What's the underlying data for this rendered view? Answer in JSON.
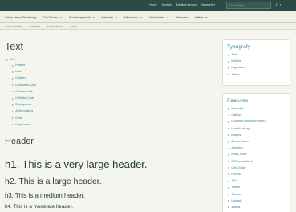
{
  "topbar": {
    "links": [
      "Home",
      "Kontakt",
      "Mitglied werden",
      "Newsletter"
    ],
    "search_placeholder": "Suchbegriff",
    "icons": [
      "facebook-icon",
      "twitter-icon"
    ]
  },
  "mainnav": {
    "items": [
      {
        "label": "Grüne Name/Gliederung",
        "dropdown": false
      },
      {
        "label": "Die Grünen",
        "dropdown": true
      },
      {
        "label": "Bundestagswahl",
        "dropdown": true
      },
      {
        "label": "Kalender",
        "dropdown": true
      },
      {
        "label": "Mitmachen",
        "dropdown": true
      },
      {
        "label": "Nachrichten",
        "dropdown": true
      },
      {
        "label": "Personen",
        "dropdown": false
      },
      {
        "label": "Intern",
        "dropdown": true
      }
    ]
  },
  "subnav": {
    "items": [
      "TYPO GRÜNE",
      "INTERN",
      "TYPOGRAFY",
      "TEXT"
    ]
  },
  "content": {
    "title": "Text",
    "toc_top": "Text",
    "toc_items": [
      "Header",
      "Links",
      "Dividers",
      "Unordered Lists",
      "Ordered Lists",
      "Definition Lists",
      "Blockquotes",
      "Abbreviations",
      "Code",
      "Keystrokes"
    ],
    "section_header": "Header",
    "h1": "h1. This is a very large header.",
    "h2": "h2. This is a large header.",
    "h3": "h3. This is a medium header.",
    "h4": "h4. This is a moderate header."
  },
  "sidebar": {
    "typografy_title": "Typografy",
    "typografy_items": [
      "Text",
      "Buttons",
      "Pagination",
      "Tables"
    ],
    "features_title": "Features",
    "features_items": [
      "Accordion",
      "Callout",
      "Drilldown Dropdown Menu",
      "Headlinestrage",
      "Images",
      "JumboTeaser",
      "Jumpbox",
      "News-Slider",
      "OffCanvas-Menü",
      "Orbit-Slider",
      "Reveal",
      "Tabs",
      "Teaser",
      "Themes",
      "Uploads",
      "Videos"
    ]
  }
}
